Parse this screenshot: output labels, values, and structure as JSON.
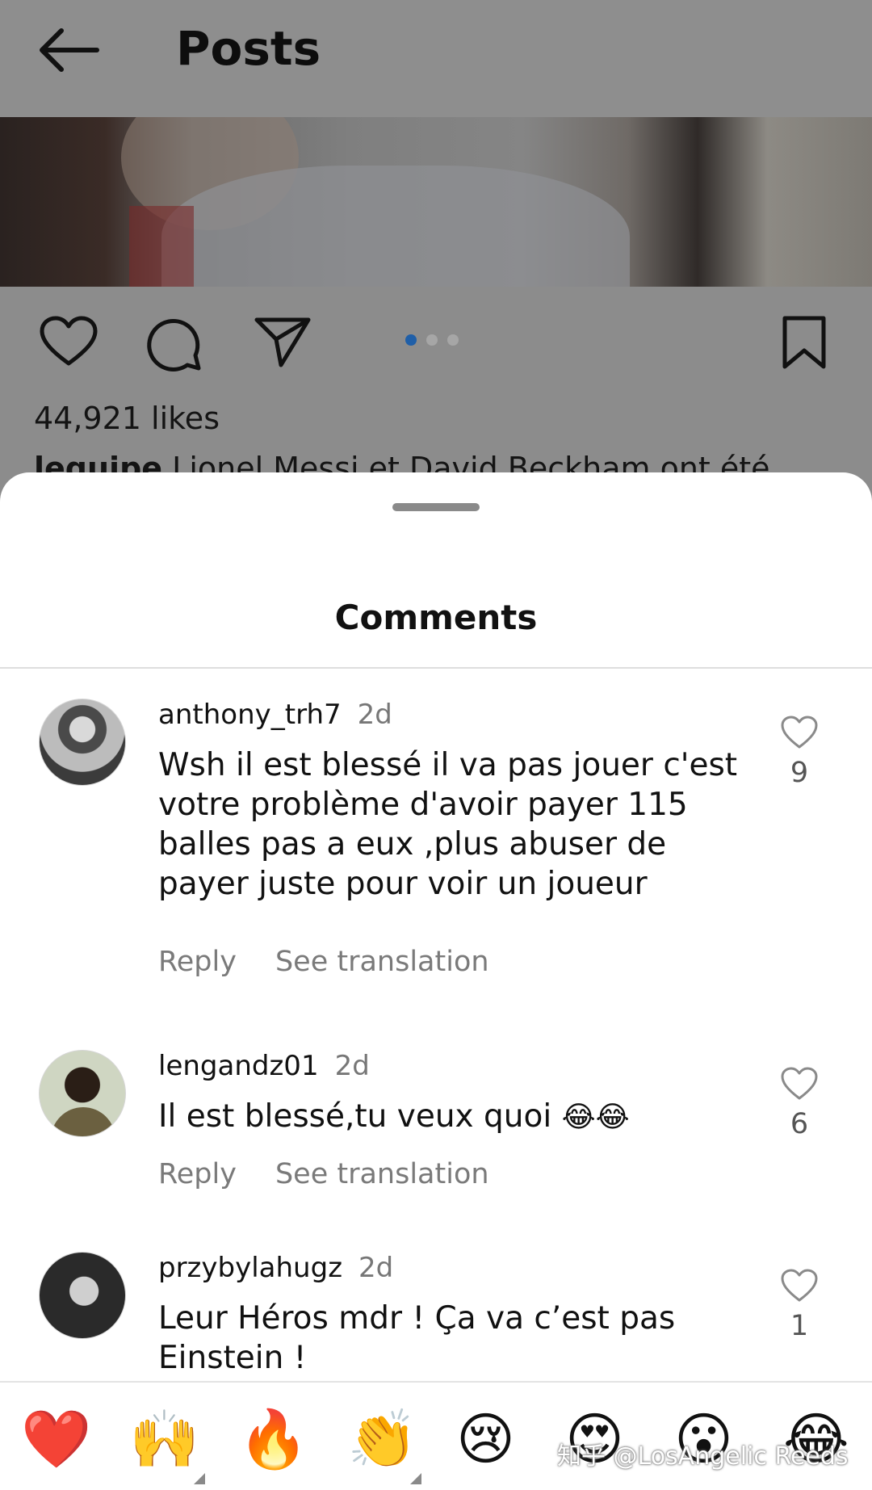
{
  "header": {
    "title": "Posts",
    "back_icon": "arrow-left-icon"
  },
  "post": {
    "likes": "44,921 likes",
    "caption_user": "lequipe",
    "caption_text": "Lionel Messi et David Beckham ont été",
    "carousel": {
      "total": 3,
      "active": 1
    },
    "actions": [
      "heart-icon",
      "comment-icon",
      "send-icon",
      "bookmark-icon"
    ]
  },
  "sheet": {
    "title": "Comments"
  },
  "comments": [
    {
      "username": "anthony_trh7",
      "time": "2d",
      "text": "Wsh il est blessé il va pas jouer c'est votre problème d'avoir payer 115 balles pas a eux ,plus abuser de payer juste pour voir un joueur",
      "likes": "9",
      "reply": "Reply",
      "translate": "See translation"
    },
    {
      "username": "lengandz01",
      "time": "2d",
      "text": "Il est blessé,tu veux quoi ",
      "emoji": "😂😂",
      "likes": "6",
      "reply": "Reply",
      "translate": "See translation"
    },
    {
      "username": "przybylahugz",
      "time": "2d",
      "text": "Leur Héros mdr ! Ça va c’est pas Einstein !",
      "likes": "1"
    }
  ],
  "reactions": [
    "❤️",
    "🙌",
    "🔥",
    "👏",
    "😢",
    "😍",
    "😮",
    "😂"
  ],
  "watermark": "知乎 @LosAngelic Reeds",
  "colors": {
    "accent_dot": "#1f5fa8",
    "dim_overlay": "#8c8c8c",
    "sheet_bg": "#ffffff"
  }
}
